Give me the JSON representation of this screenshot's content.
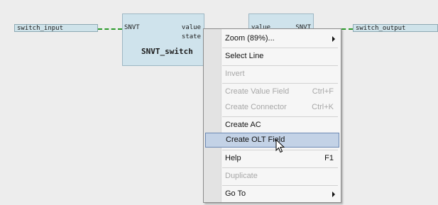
{
  "diagram": {
    "input_label": "switch_input",
    "output_label": "switch_output",
    "block1": {
      "type": "SNVT",
      "port_value": "value",
      "port_state": "state",
      "name": "SNVT_switch"
    },
    "block2": {
      "port_value": "value",
      "type": "SNVT"
    }
  },
  "context_menu": {
    "items": [
      {
        "label": "Zoom (89%)...",
        "shortcut": "",
        "enabled": true,
        "submenu": true
      },
      {
        "label": "Select Line",
        "shortcut": "",
        "enabled": true,
        "submenu": false
      },
      {
        "label": "Invert",
        "shortcut": "",
        "enabled": false,
        "submenu": false
      },
      {
        "label": "Create Value Field",
        "shortcut": "Ctrl+F",
        "enabled": false,
        "submenu": false
      },
      {
        "label": "Create Connector",
        "shortcut": "Ctrl+K",
        "enabled": false,
        "submenu": false
      },
      {
        "label": "Create AC",
        "shortcut": "",
        "enabled": true,
        "submenu": false
      },
      {
        "label": "Create OLT Field",
        "shortcut": "",
        "enabled": true,
        "submenu": false,
        "highlighted": true
      },
      {
        "label": "Help",
        "shortcut": "F1",
        "enabled": true,
        "submenu": false
      },
      {
        "label": "Duplicate",
        "shortcut": "",
        "enabled": false,
        "submenu": false
      },
      {
        "label": "Go To",
        "shortcut": "",
        "enabled": true,
        "submenu": true
      }
    ]
  },
  "icons": {
    "cursor": "arrow-cursor-icon",
    "submenu": "submenu-arrow-icon"
  }
}
